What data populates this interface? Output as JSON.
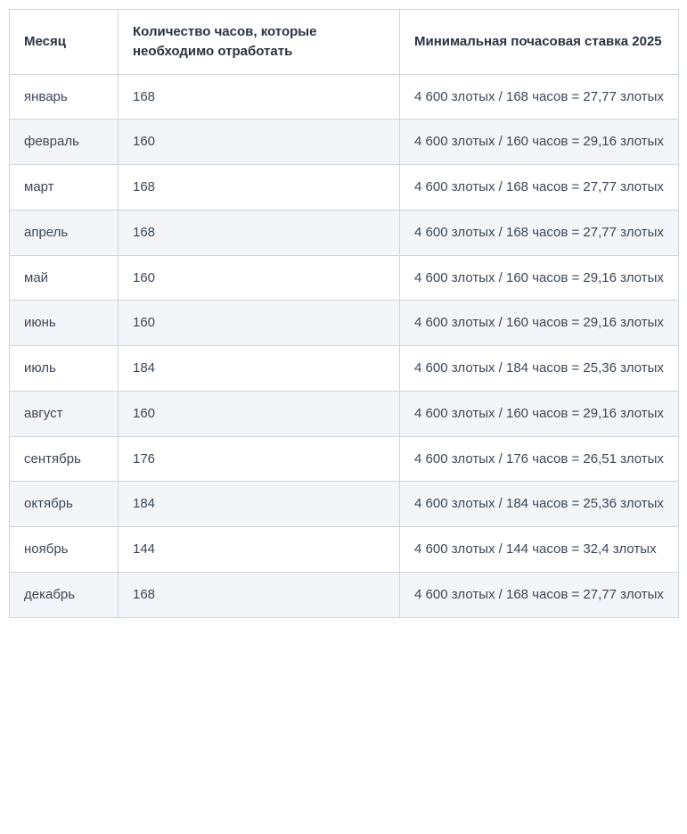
{
  "table": {
    "headers": {
      "month": "Месяц",
      "hours": "Количество часов, которые необходимо отработать",
      "rate": "Минимальная почасовая ставка 2025"
    },
    "rows": [
      {
        "month": "январь",
        "hours": "168",
        "rate": "4 600 злотых / 168 часов = 27,77 злотых"
      },
      {
        "month": "февраль",
        "hours": "160",
        "rate": "4 600 злотых / 160 часов = 29,16 злотых"
      },
      {
        "month": "март",
        "hours": "168",
        "rate": "4 600 злотых / 168 часов = 27,77 злотых"
      },
      {
        "month": "апрель",
        "hours": "168",
        "rate": "4 600 злотых / 168 часов = 27,77 злотых"
      },
      {
        "month": "май",
        "hours": "160",
        "rate": "4 600 злотых / 160 часов = 29,16 злотых"
      },
      {
        "month": "июнь",
        "hours": "160",
        "rate": "4 600 злотых / 160 часов = 29,16 злотых"
      },
      {
        "month": "июль",
        "hours": "184",
        "rate": "4 600 злотых / 184 часов = 25,36 злотых"
      },
      {
        "month": "август",
        "hours": "160",
        "rate": "4 600 злотых / 160 часов = 29,16 злотых"
      },
      {
        "month": "сентябрь",
        "hours": "176",
        "rate": "4 600 злотых / 176 часов = 26,51 злотых"
      },
      {
        "month": "октябрь",
        "hours": "184",
        "rate": "4 600 злотых / 184 часов = 25,36 злотых"
      },
      {
        "month": "ноябрь",
        "hours": "144",
        "rate": "4 600 злотых / 144 часов = 32,4 злотых"
      },
      {
        "month": "декабрь",
        "hours": "168",
        "rate": "4 600 злотых / 168 часов = 27,77 злотых"
      }
    ]
  }
}
